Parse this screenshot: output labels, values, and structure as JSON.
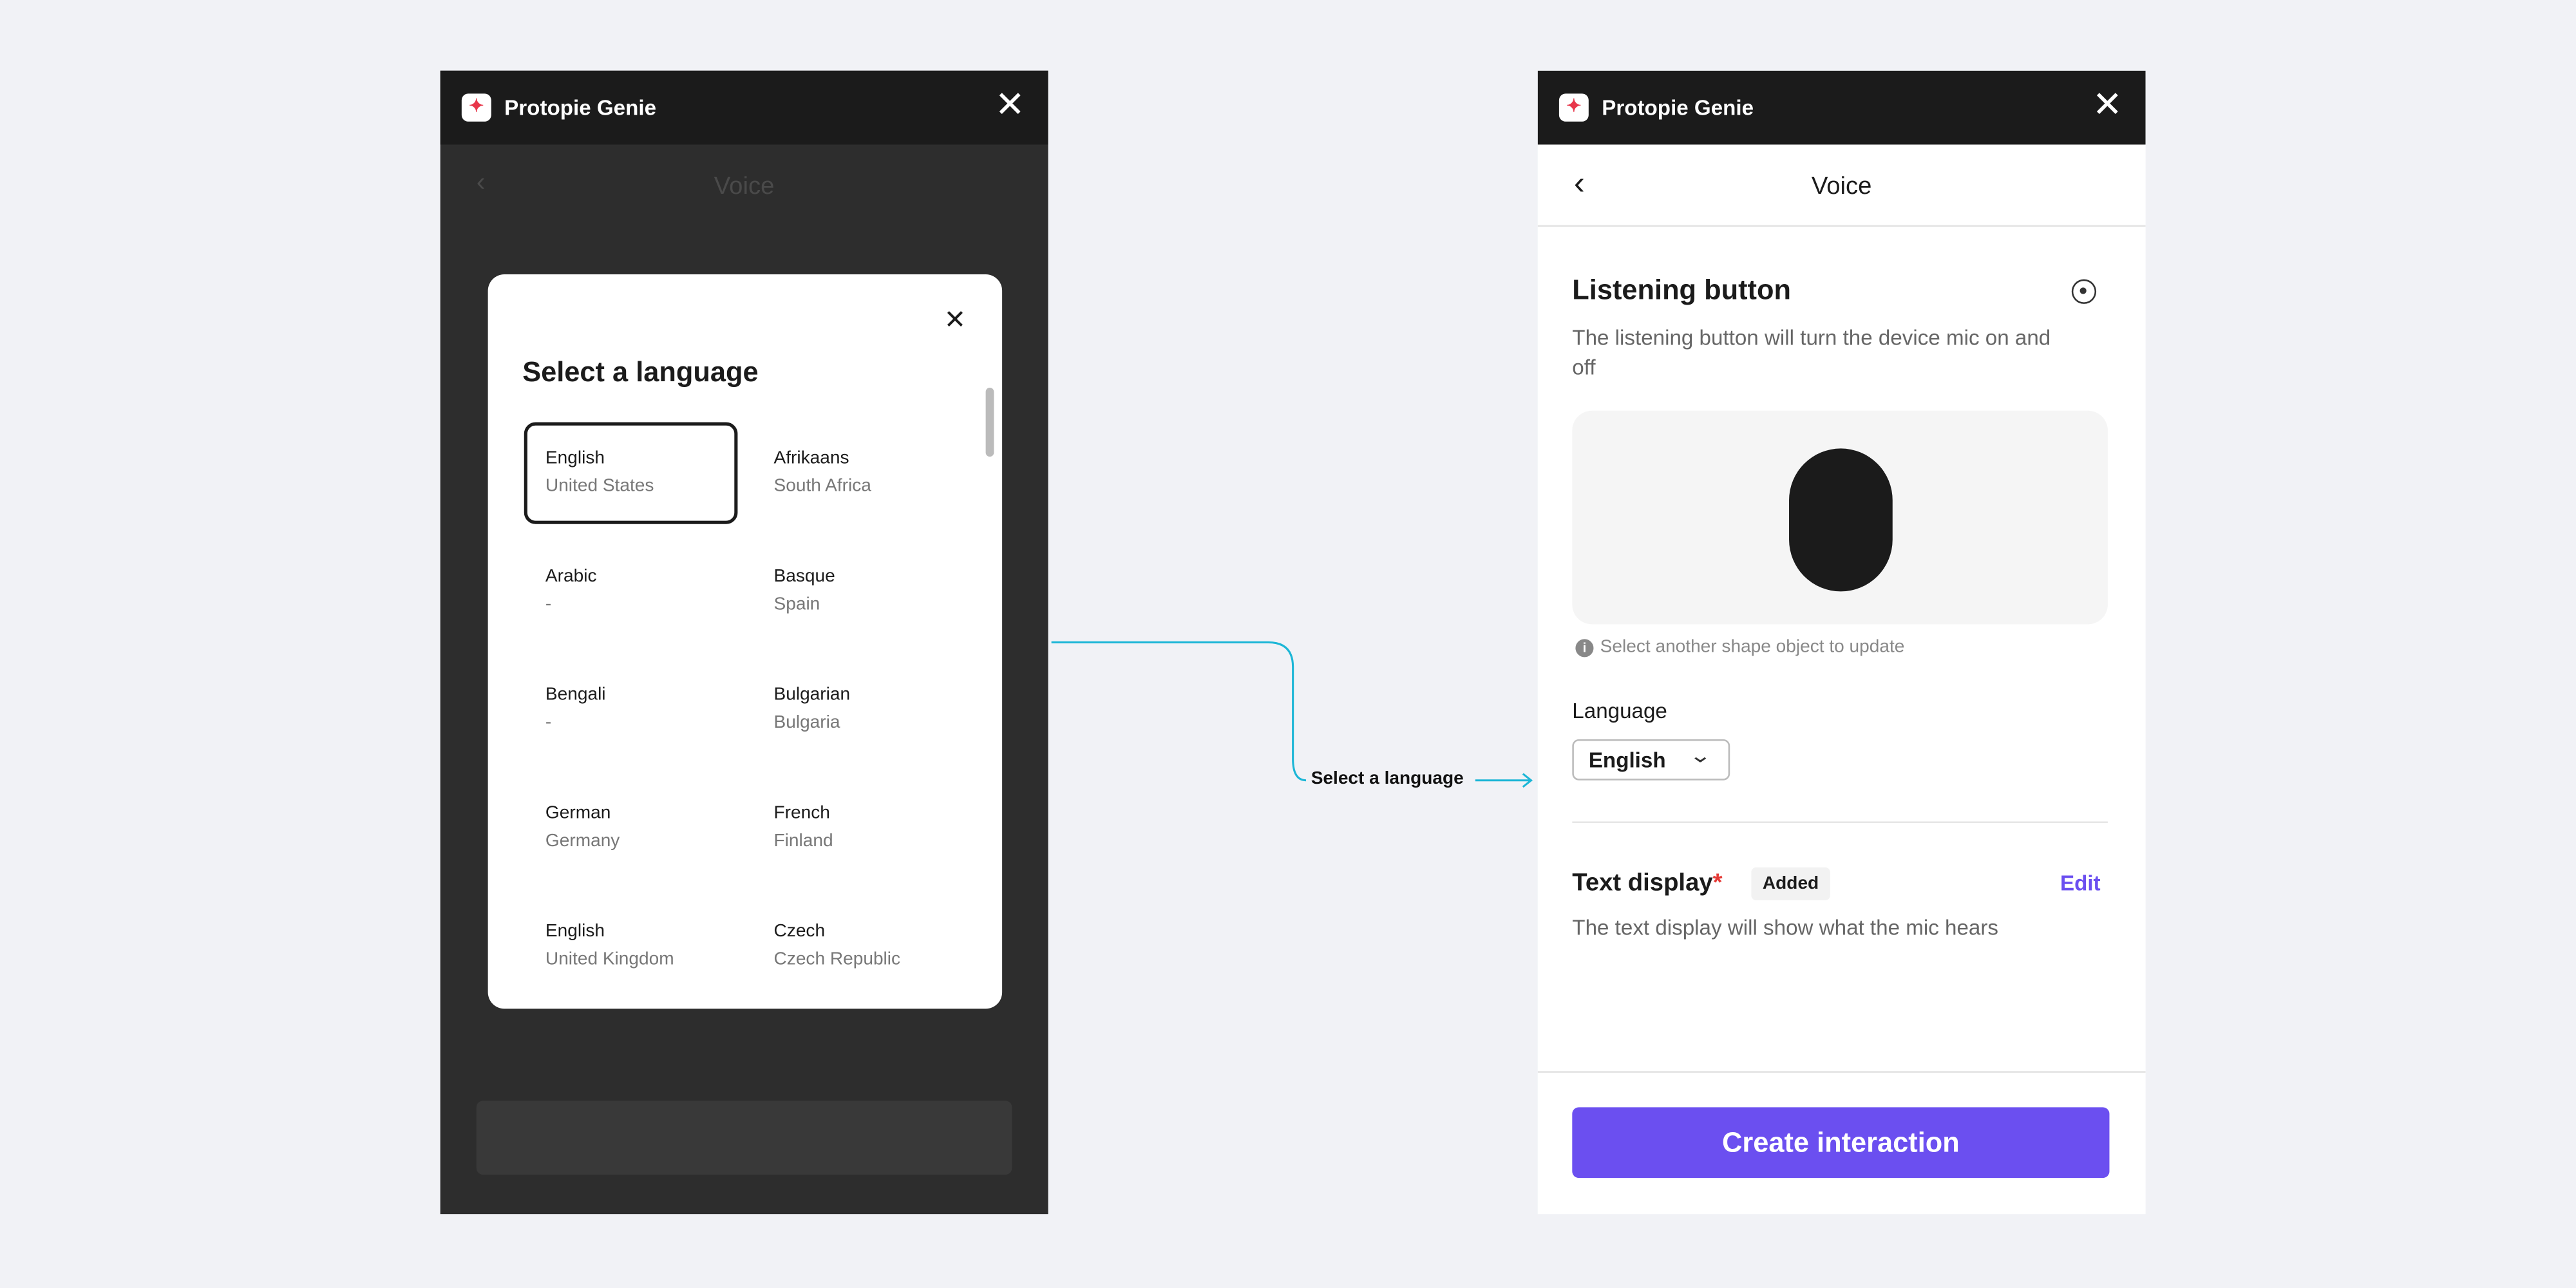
{
  "app_title": "Protopie Genie",
  "left": {
    "background_title": "Voice",
    "modal": {
      "title": "Select a language",
      "languages": [
        {
          "name": "English",
          "region": "United States",
          "selected": true
        },
        {
          "name": "Afrikaans",
          "region": "South Africa"
        },
        {
          "name": "Arabic",
          "region": "-"
        },
        {
          "name": "Basque",
          "region": "Spain"
        },
        {
          "name": "Bengali",
          "region": "-"
        },
        {
          "name": "Bulgarian",
          "region": "Bulgaria"
        },
        {
          "name": "German",
          "region": "Germany"
        },
        {
          "name": "French",
          "region": "Finland"
        },
        {
          "name": "English",
          "region": "United Kingdom"
        },
        {
          "name": "Czech",
          "region": "Czech Republic"
        }
      ]
    }
  },
  "connector": {
    "label": "Select a language",
    "color": "#1cb6d6"
  },
  "right": {
    "nav_title": "Voice",
    "listening": {
      "title": "Listening button",
      "description": "The listening button will turn the device mic on and off",
      "hint": "Select another shape object to update"
    },
    "language": {
      "label": "Language",
      "value": "English"
    },
    "text_display": {
      "title": "Text display",
      "required": "*",
      "badge": "Added",
      "edit": "Edit",
      "description": "The text display will show what the mic hears"
    },
    "create_button": "Create interaction",
    "accent": "#6b4ff0"
  }
}
